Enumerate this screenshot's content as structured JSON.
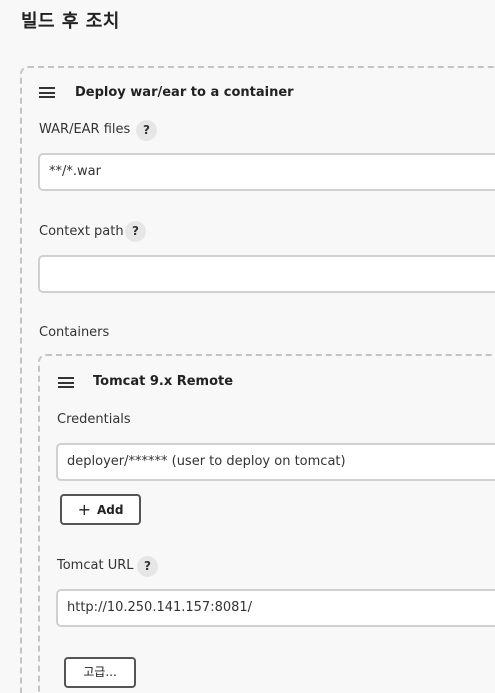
{
  "section": {
    "title": "빌드 후 조치"
  },
  "deploy": {
    "title": "Deploy war/ear to a container",
    "war_label": "WAR/EAR files",
    "war_value": "**/*.war",
    "context_label": "Context path",
    "context_value": "",
    "containers_label": "Containers",
    "help_glyph": "?"
  },
  "container": {
    "title": "Tomcat 9.x Remote",
    "credentials_label": "Credentials",
    "credentials_value": "deployer/****** (user to deploy on tomcat)",
    "add_plus": "+",
    "add_label": "Add",
    "url_label": "Tomcat URL",
    "url_value": "http://10.250.141.157:8081/",
    "advanced_label": "고급..."
  }
}
